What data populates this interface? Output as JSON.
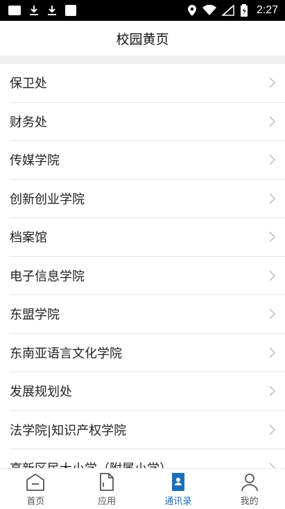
{
  "status_bar": {
    "time": "2:27"
  },
  "header": {
    "title": "校园黄页"
  },
  "directory": [
    {
      "label": "保卫处"
    },
    {
      "label": "财务处"
    },
    {
      "label": "传媒学院"
    },
    {
      "label": "创新创业学院"
    },
    {
      "label": "档案馆"
    },
    {
      "label": "电子信息学院"
    },
    {
      "label": "东盟学院"
    },
    {
      "label": "东南亚语言文化学院"
    },
    {
      "label": "发展规划处"
    },
    {
      "label": "法学院|知识产权学院"
    },
    {
      "label": "高新区民大小学（附属小学）"
    }
  ],
  "tabs": [
    {
      "label": "首页",
      "icon": "home-icon",
      "active": false
    },
    {
      "label": "应用",
      "icon": "document-icon",
      "active": false
    },
    {
      "label": "通讯录",
      "icon": "contacts-icon",
      "active": true
    },
    {
      "label": "我的",
      "icon": "profile-icon",
      "active": false
    }
  ],
  "colors": {
    "accent": "#1c6fb8",
    "status_bar": "#000000",
    "divider_band": "#efefef"
  }
}
